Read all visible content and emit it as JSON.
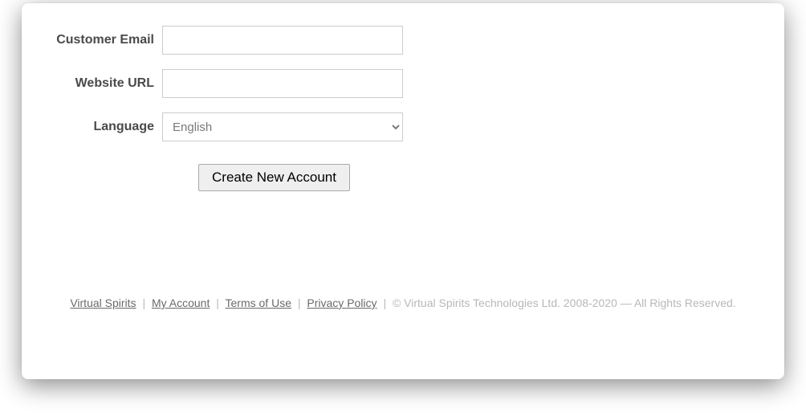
{
  "form": {
    "email_label": "Customer Email",
    "email_value": "",
    "url_label": "Website URL",
    "url_value": "",
    "language_label": "Language",
    "language_selected": "English",
    "submit_label": "Create New Account"
  },
  "footer": {
    "links": {
      "virtual_spirits": "Virtual Spirits",
      "my_account": "My Account",
      "terms": "Terms of Use",
      "privacy": "Privacy Policy"
    },
    "separator": "|",
    "copyright": "© Virtual Spirits Technologies Ltd. 2008-2020 — All Rights Reserved."
  }
}
